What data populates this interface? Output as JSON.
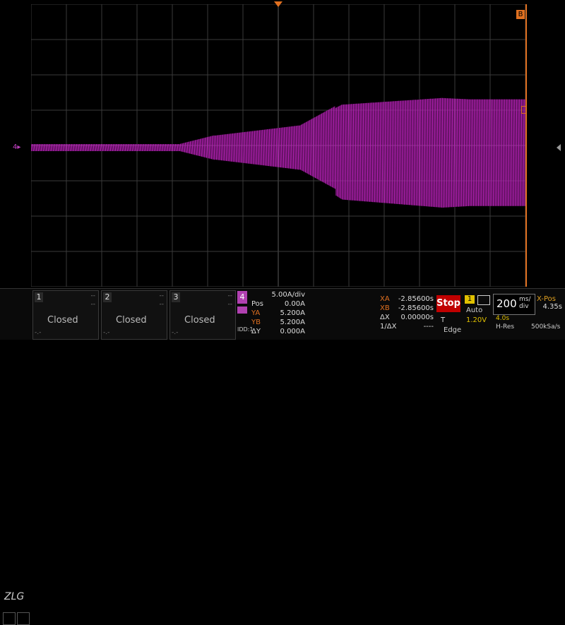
{
  "channel_marker": "4",
  "trigger_marker_label": "B",
  "logo": "ZLG",
  "channels_closed": [
    {
      "num": "1",
      "label": "Closed",
      "a": "--",
      "b": "--",
      "c": "-.-"
    },
    {
      "num": "2",
      "label": "Closed",
      "a": "--",
      "b": "--",
      "c": "-.-"
    },
    {
      "num": "3",
      "label": "Closed",
      "a": "--",
      "b": "--",
      "c": "-.-"
    }
  ],
  "ch4": {
    "num": "4",
    "scale": "5.00A/div",
    "pos_label": "Pos",
    "pos_value": "0.00A",
    "ya_label": "YA",
    "ya_value": "5.200A",
    "yb_label": "YB",
    "yb_value": "5.200A",
    "dy_label": "ΔY",
    "dy_value": "0.000A",
    "sub": "IDD:1"
  },
  "measure": {
    "xa_label": "XA",
    "xa_value": "-2.85600s",
    "xb_label": "XB",
    "xb_value": "-2.85600s",
    "dx_label": "ΔX",
    "dx_value": "0.00000s",
    "inv_label": "1/ΔX",
    "inv_value": "----"
  },
  "run_state": "Stop",
  "trigger": {
    "src": "1",
    "mode": "Auto",
    "t_label": "T",
    "level": "1.20V",
    "type": "Edge"
  },
  "timebase": {
    "value": "200",
    "unit_top": "ms/",
    "unit_bottom": "div"
  },
  "xpos": {
    "label": "X-Pos",
    "value": "4.35s",
    "extra": "4.0s",
    "hres": "H-Res",
    "rate": "500kSa/s"
  },
  "colors": {
    "wave": "#b020b0",
    "grid": "#3a3a3a",
    "accent": "#e07020"
  }
}
